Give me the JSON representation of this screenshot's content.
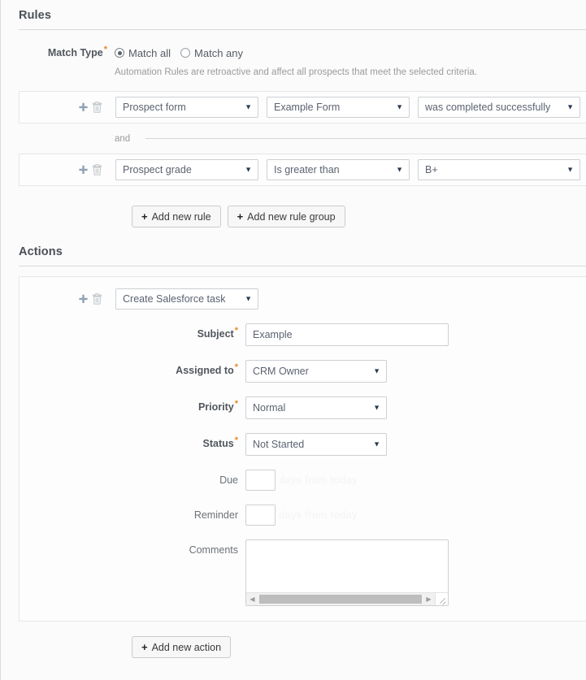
{
  "rules_section": {
    "title": "Rules",
    "match_type": {
      "label": "Match Type",
      "options": [
        {
          "label": "Match all",
          "selected": true
        },
        {
          "label": "Match any",
          "selected": false
        }
      ],
      "help_text": "Automation Rules are retroactive and affect all prospects that meet the selected criteria."
    },
    "rows": [
      {
        "field": "Prospect form",
        "value": "Example Form",
        "operator": "was completed successfully"
      },
      {
        "field": "Prospect grade",
        "operator": "Is greater than",
        "value": "B+"
      }
    ],
    "conjunction": "and",
    "buttons": {
      "add_rule": "Add new rule",
      "add_rule_group": "Add new rule group"
    }
  },
  "actions_section": {
    "title": "Actions",
    "action_type": "Create Salesforce task",
    "fields": {
      "subject": {
        "label": "Subject",
        "value": "Example"
      },
      "assigned_to": {
        "label": "Assigned to",
        "value": "CRM Owner"
      },
      "priority": {
        "label": "Priority",
        "value": "Normal"
      },
      "status": {
        "label": "Status",
        "value": "Not Started"
      },
      "due": {
        "label": "Due",
        "value": "",
        "hint": "days from today"
      },
      "reminder": {
        "label": "Reminder",
        "value": "",
        "hint": "days from today"
      },
      "comments": {
        "label": "Comments",
        "value": ""
      }
    },
    "buttons": {
      "add_action": "Add new action"
    }
  },
  "icons": {
    "plus": "plus-icon",
    "trash": "trash-icon",
    "caret": "▼",
    "plus_glyph": "+",
    "arrow_left": "◀",
    "arrow_right": "▶"
  },
  "colors": {
    "required_star": "#e8892b",
    "plus_icon": "#8fa0b5",
    "trash_icon": "#c5c9cd",
    "page_bg": "#fbfbfb"
  }
}
